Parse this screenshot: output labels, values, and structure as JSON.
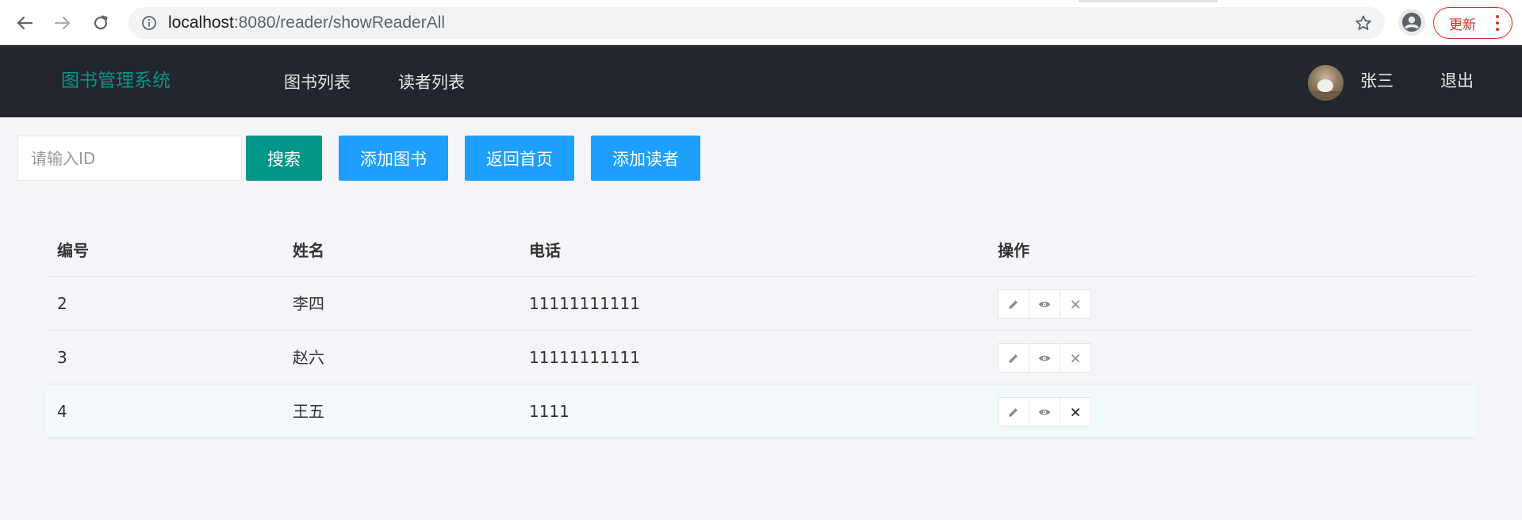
{
  "browser": {
    "url_host": "localhost",
    "url_path": ":8080/reader/showReaderAll",
    "update_label": "更新"
  },
  "header": {
    "brand": "图书管理系统",
    "nav": [
      {
        "label": "图书列表"
      },
      {
        "label": "读者列表"
      }
    ],
    "user_name": "张三",
    "logout_label": "退出"
  },
  "toolbar": {
    "search_placeholder": "请输入ID",
    "search_value": "",
    "search_label": "搜索",
    "add_book_label": "添加图书",
    "home_label": "返回首页",
    "add_reader_label": "添加读者"
  },
  "table": {
    "columns": [
      "编号",
      "姓名",
      "电话",
      "操作"
    ],
    "rows": [
      {
        "id": "2",
        "name": "李四",
        "phone": "11111111111"
      },
      {
        "id": "3",
        "name": "赵六",
        "phone": "11111111111"
      },
      {
        "id": "4",
        "name": "王五",
        "phone": "1111"
      }
    ]
  },
  "icons": {
    "edit": "pencil-icon",
    "view": "eye-icon",
    "delete": "close-icon"
  },
  "colors": {
    "header_bg": "#23262e",
    "brand": "#009688",
    "primary_green": "#009688",
    "primary_blue": "#1e9fff",
    "update_red": "#d93025"
  }
}
